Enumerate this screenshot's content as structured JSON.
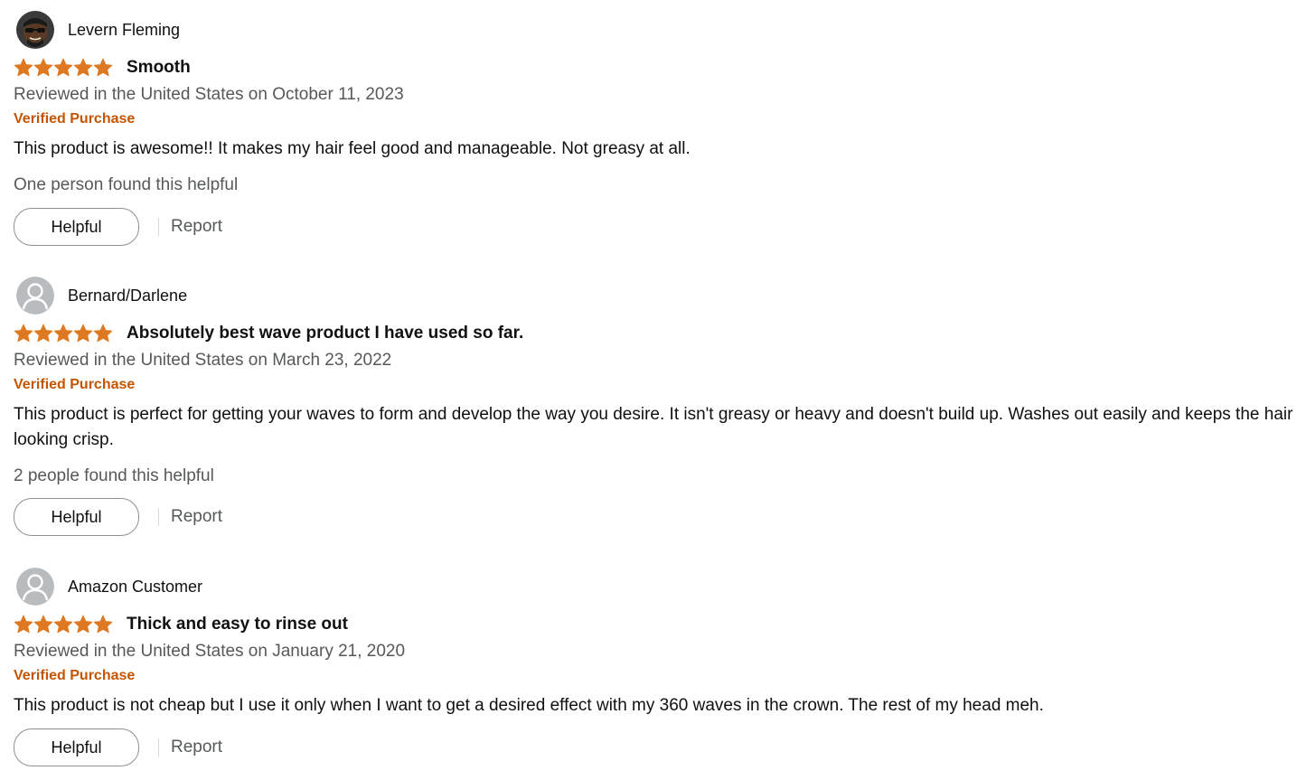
{
  "colors": {
    "star": "#de7921",
    "verified": "#c45500",
    "secondary_text": "#565959",
    "primary_text": "#0f1111",
    "button_border": "#8d9096"
  },
  "reviews": [
    {
      "author": "Levern Fleming",
      "avatar_icon": "person-photo-avatar",
      "rating": 5,
      "rating_max": 5,
      "title": "Smooth",
      "date": "Reviewed in the United States on October 11, 2023",
      "verified": "Verified Purchase",
      "body": "This product is awesome!! It makes my hair feel good and manageable. Not greasy at all.",
      "helpful_count": "One person found this helpful",
      "helpful_label": "Helpful",
      "report_label": "Report"
    },
    {
      "author": "Bernard/Darlene",
      "avatar_icon": "default-user-avatar",
      "rating": 5,
      "rating_max": 5,
      "title": "Absolutely best wave product I have used so far.",
      "date": "Reviewed in the United States on March 23, 2022",
      "verified": "Verified Purchase",
      "body": "This product is perfect for getting your waves to form and develop the way you desire. It isn't greasy or heavy and doesn't build up. Washes out easily and keeps the hair looking crisp.",
      "helpful_count": "2 people found this helpful",
      "helpful_label": "Helpful",
      "report_label": "Report"
    },
    {
      "author": "Amazon Customer",
      "avatar_icon": "default-user-avatar",
      "rating": 5,
      "rating_max": 5,
      "title": "Thick and easy to rinse out",
      "date": "Reviewed in the United States on January 21, 2020",
      "verified": "Verified Purchase",
      "body": "This product is not cheap but I use it only when I want to get a desired effect with my 360 waves in the crown. The rest of my head meh.",
      "helpful_label": "Helpful",
      "report_label": "Report"
    }
  ]
}
